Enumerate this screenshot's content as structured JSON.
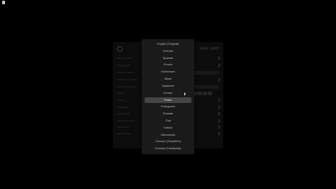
{
  "app": {
    "icons": {
      "corner": "app-icon",
      "home": "home-icon",
      "cursor": "mouse-cursor-icon"
    }
  },
  "settings": {
    "rows": [
      {
        "label": "Multi-cam Mode"
      },
      {
        "label": "Camera Mode"
      },
      {
        "label": "Production Mode"
      },
      {
        "label": "Production Language"
      },
      {
        "label": "Camera Orientation"
      },
      {
        "label": "Display"
      },
      {
        "label": "Subtitles"
      },
      {
        "label": "Audio Mode"
      },
      {
        "label": "Audio Quality"
      },
      {
        "label": "Performance Mode"
      },
      {
        "label": "About Device"
      },
      {
        "label": "Reset Settings"
      }
    ]
  },
  "language_menu": {
    "options": [
      "English (Original)",
      "German",
      "Spanish",
      "French",
      "Indonesian",
      "Italian",
      "Japanese",
      "Korean",
      "Polish",
      "Portuguese",
      "Russian",
      "Thai",
      "Turkish",
      "Vietnamese",
      "Chinese (Simplified)",
      "Chinese (Traditional)"
    ],
    "selected_index": 8,
    "selected": "Polish"
  },
  "colors": {
    "background": "#000000",
    "menu_background": "#1a1a1a",
    "selected_highlight": "#454545",
    "option_text": "#bdbdbd"
  }
}
